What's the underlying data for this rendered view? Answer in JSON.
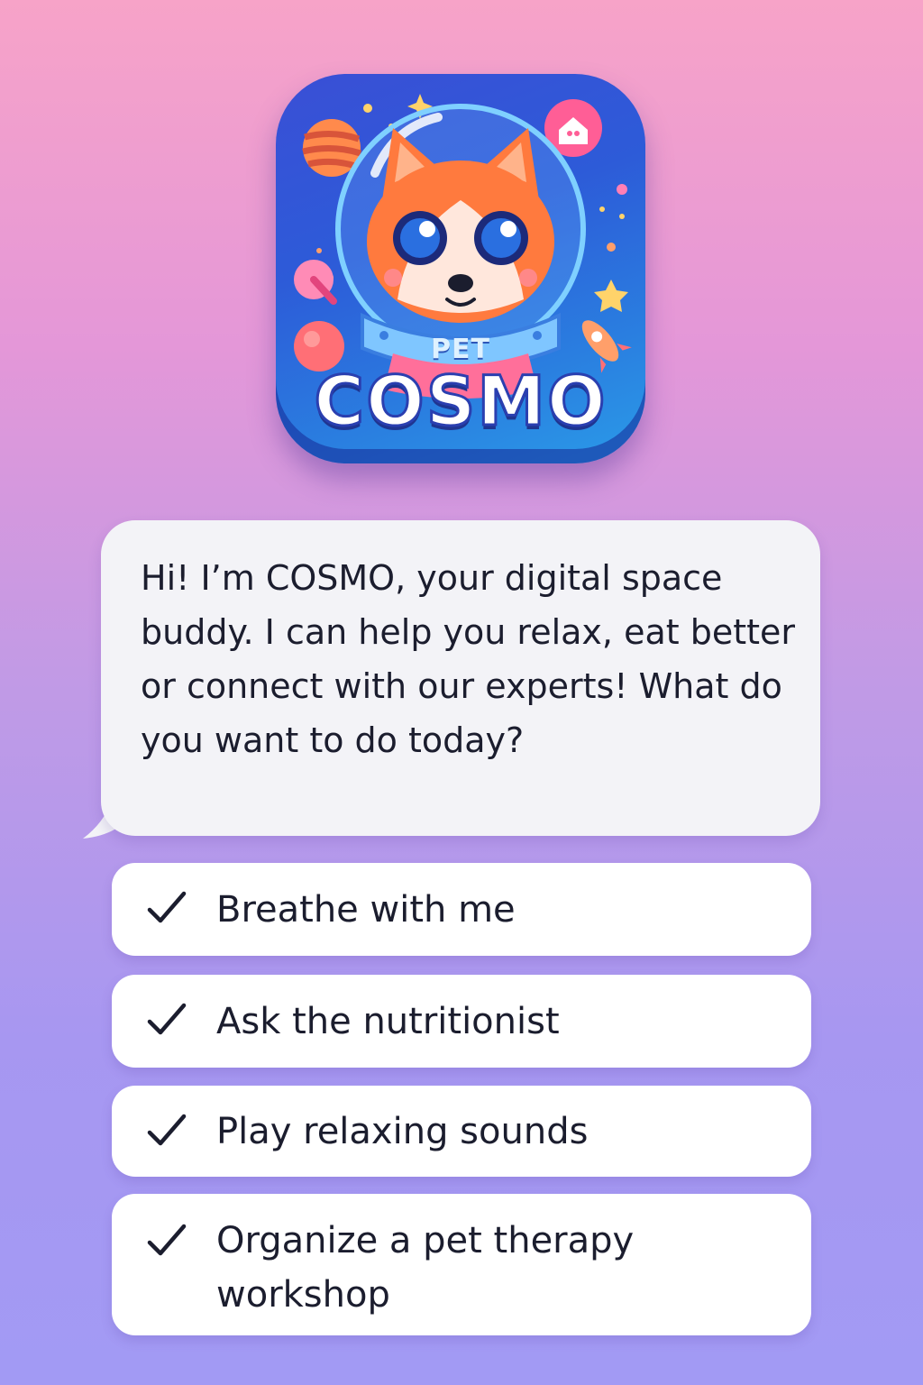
{
  "app_icon": {
    "small_label": "PET",
    "name": "COSMO",
    "icon": "space-dog-astronaut-icon"
  },
  "chat": {
    "message": "Hi! I’m COSMO, your digital space buddy. I can help you relax, eat better or connect with our experts! What do you want to do today?"
  },
  "options": [
    {
      "label": "Breathe with me",
      "icon": "checkmark-icon"
    },
    {
      "label": "Ask the nutritionist",
      "icon": "checkmark-icon"
    },
    {
      "label": "Play relaxing sounds",
      "icon": "checkmark-icon"
    },
    {
      "label": "Organize a pet therapy workshop",
      "icon": "checkmark-icon"
    }
  ],
  "colors": {
    "background_top": "#f7a3c8",
    "background_bottom": "#a29af4",
    "icon_blue": "#2d5bd8",
    "text": "#1b1d2e"
  }
}
